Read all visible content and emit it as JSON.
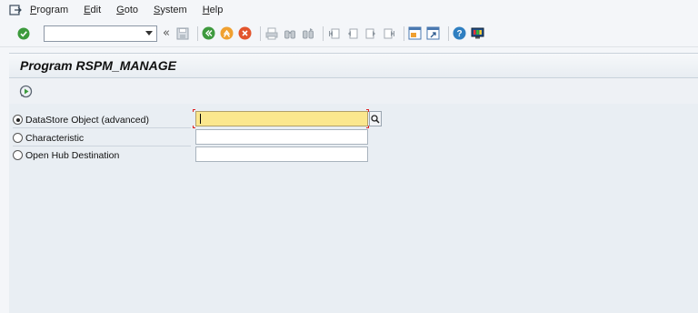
{
  "menu": {
    "items": [
      {
        "label": "Program",
        "u": "P"
      },
      {
        "label": "Edit",
        "u": "E"
      },
      {
        "label": "Goto",
        "u": "G"
      },
      {
        "label": "System",
        "u": "S"
      },
      {
        "label": "Help",
        "u": "H"
      }
    ]
  },
  "toolbar": {
    "command_field_value": "",
    "collapse_label": "«",
    "icons": [
      "enter-icon",
      "save-icon",
      "back-icon",
      "exit-icon",
      "cancel-icon",
      "print-icon",
      "find-icon",
      "find-next-icon",
      "first-page-icon",
      "previous-page-icon",
      "next-page-icon",
      "last-page-icon",
      "new-session-icon",
      "shortcut-icon",
      "help-icon",
      "customize-layout-icon"
    ]
  },
  "title": "Program RSPM_MANAGE",
  "app_toolbar": {
    "icons": [
      "execute-icon"
    ]
  },
  "form": {
    "options": [
      {
        "label": "DataStore Object (advanced)",
        "selected": true,
        "value": ""
      },
      {
        "label": "Characteristic",
        "selected": false,
        "value": ""
      },
      {
        "label": "Open Hub Destination",
        "selected": false,
        "value": ""
      }
    ]
  },
  "colors": {
    "active_field": "#fbe78e",
    "background": "#e9eef3",
    "title_text": "#111111"
  }
}
